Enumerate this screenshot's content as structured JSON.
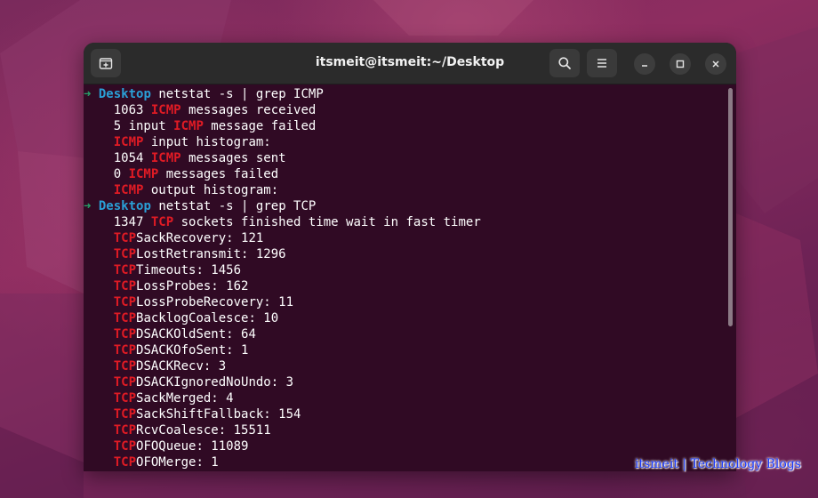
{
  "window": {
    "title": "itsmeit@itsmeit:~/Desktop",
    "icons": {
      "new_tab": "new-tab-icon",
      "search": "search-icon",
      "menu": "hamburger-menu-icon",
      "minimize": "minimize-icon",
      "maximize": "maximize-icon",
      "close": "close-icon"
    }
  },
  "colors": {
    "terminal_bg": "#300a24",
    "prompt_arrow": "#26a269",
    "prompt_dir": "#2a9fd6",
    "grep_match": "#e01b24",
    "titlebar_bg": "#2b2b2b"
  },
  "terminal": {
    "lines": [
      {
        "type": "prompt",
        "arrow": "➜",
        "dir": "Desktop",
        "cmd": "netstat -s | grep ICMP"
      },
      {
        "type": "output",
        "indent": "    ",
        "pre": "1063 ",
        "match": "ICMP",
        "post": " messages received"
      },
      {
        "type": "output",
        "indent": "    ",
        "pre": "5 input ",
        "match": "ICMP",
        "post": " message failed"
      },
      {
        "type": "output",
        "indent": "    ",
        "pre": "",
        "match": "ICMP",
        "post": " input histogram:"
      },
      {
        "type": "output",
        "indent": "    ",
        "pre": "1054 ",
        "match": "ICMP",
        "post": " messages sent"
      },
      {
        "type": "output",
        "indent": "    ",
        "pre": "0 ",
        "match": "ICMP",
        "post": " messages failed"
      },
      {
        "type": "output",
        "indent": "    ",
        "pre": "",
        "match": "ICMP",
        "post": " output histogram:"
      },
      {
        "type": "prompt",
        "arrow": "➜",
        "dir": "Desktop",
        "cmd": "netstat -s | grep TCP"
      },
      {
        "type": "output",
        "indent": "    ",
        "pre": "1347 ",
        "match": "TCP",
        "post": " sockets finished time wait in fast timer"
      },
      {
        "type": "output",
        "indent": "    ",
        "pre": "",
        "match": "TCP",
        "post": "SackRecovery: 121"
      },
      {
        "type": "output",
        "indent": "    ",
        "pre": "",
        "match": "TCP",
        "post": "LostRetransmit: 1296"
      },
      {
        "type": "output",
        "indent": "    ",
        "pre": "",
        "match": "TCP",
        "post": "Timeouts: 1456"
      },
      {
        "type": "output",
        "indent": "    ",
        "pre": "",
        "match": "TCP",
        "post": "LossProbes: 162"
      },
      {
        "type": "output",
        "indent": "    ",
        "pre": "",
        "match": "TCP",
        "post": "LossProbeRecovery: 11"
      },
      {
        "type": "output",
        "indent": "    ",
        "pre": "",
        "match": "TCP",
        "post": "BacklogCoalesce: 10"
      },
      {
        "type": "output",
        "indent": "    ",
        "pre": "",
        "match": "TCP",
        "post": "DSACKOldSent: 64"
      },
      {
        "type": "output",
        "indent": "    ",
        "pre": "",
        "match": "TCP",
        "post": "DSACKOfoSent: 1"
      },
      {
        "type": "output",
        "indent": "    ",
        "pre": "",
        "match": "TCP",
        "post": "DSACKRecv: 3"
      },
      {
        "type": "output",
        "indent": "    ",
        "pre": "",
        "match": "TCP",
        "post": "DSACKIgnoredNoUndo: 3"
      },
      {
        "type": "output",
        "indent": "    ",
        "pre": "",
        "match": "TCP",
        "post": "SackMerged: 4"
      },
      {
        "type": "output",
        "indent": "    ",
        "pre": "",
        "match": "TCP",
        "post": "SackShiftFallback: 154"
      },
      {
        "type": "output",
        "indent": "    ",
        "pre": "",
        "match": "TCP",
        "post": "RcvCoalesce: 15511"
      },
      {
        "type": "output",
        "indent": "    ",
        "pre": "",
        "match": "TCP",
        "post": "OFOQueue: 11089"
      },
      {
        "type": "output",
        "indent": "    ",
        "pre": "",
        "match": "TCP",
        "post": "OFOMerge: 1"
      }
    ]
  },
  "watermark": {
    "text": "itsmeit | Technology Blogs"
  }
}
